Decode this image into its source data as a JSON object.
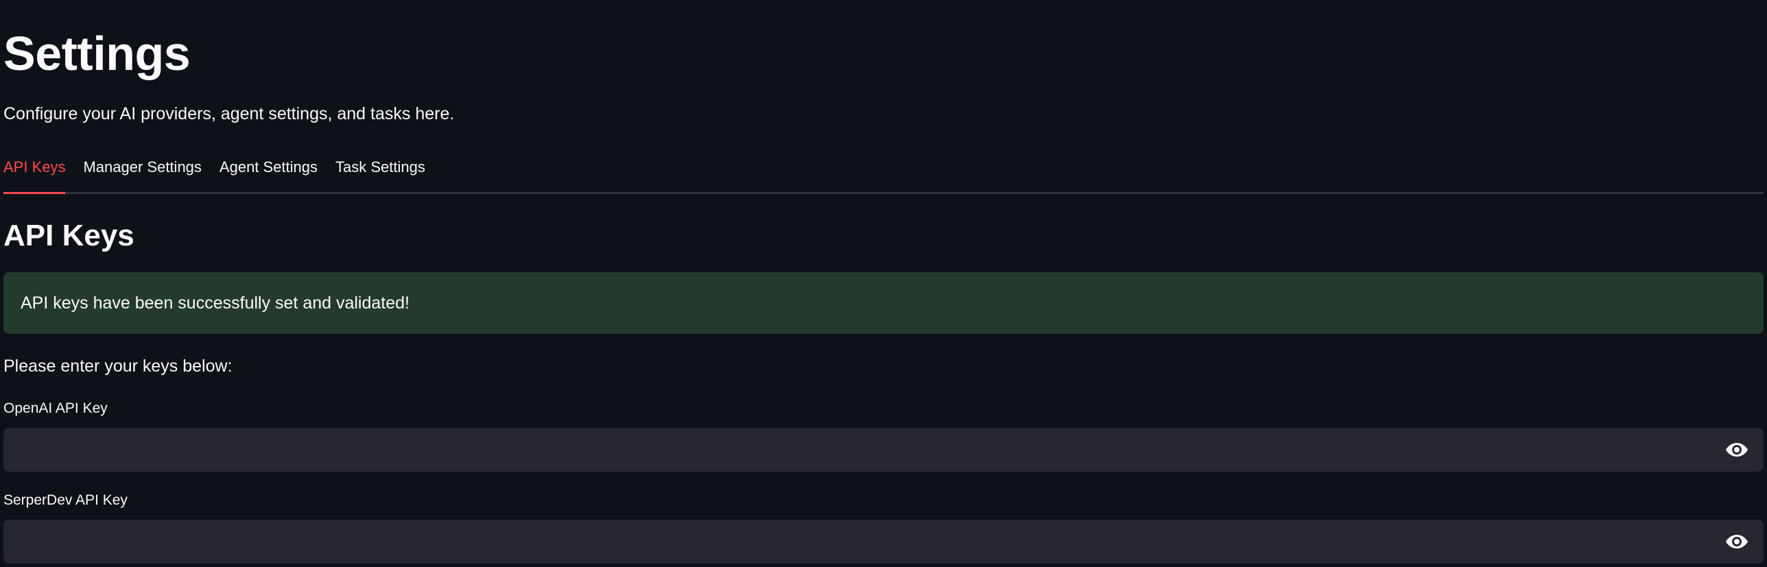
{
  "header": {
    "title": "Settings",
    "subtitle": "Configure your AI providers, agent settings, and tasks here."
  },
  "tabs": [
    {
      "label": "API Keys",
      "active": true
    },
    {
      "label": "Manager Settings",
      "active": false
    },
    {
      "label": "Agent Settings",
      "active": false
    },
    {
      "label": "Task Settings",
      "active": false
    }
  ],
  "api_keys": {
    "section_title": "API Keys",
    "success_message": "API keys have been successfully set and validated!",
    "prompt": "Please enter your keys below:",
    "fields": [
      {
        "label": "OpenAI API Key",
        "value": "",
        "icon": "eye-icon"
      },
      {
        "label": "SerperDev API Key",
        "value": "",
        "icon": "eye-icon"
      }
    ]
  },
  "colors": {
    "background": "#0e1117",
    "accent": "#ff4b4b",
    "success_bg": "#233a2d",
    "input_bg": "#262730",
    "text": "#fafafa"
  }
}
